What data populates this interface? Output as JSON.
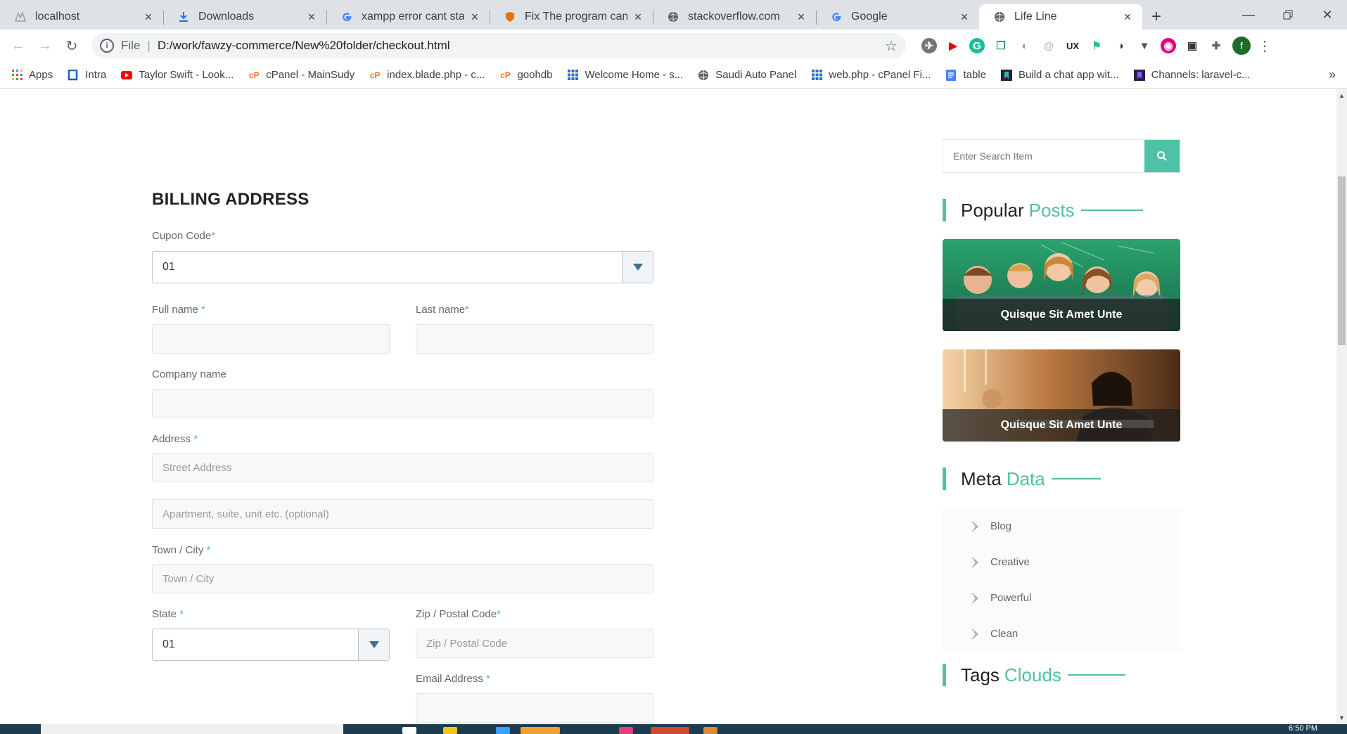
{
  "browser": {
    "tabs": [
      {
        "title": "localhost",
        "icon": "xampp-icon"
      },
      {
        "title": "Downloads",
        "icon": "download-icon"
      },
      {
        "title": "xampp error cant start",
        "icon": "google-icon"
      },
      {
        "title": "Fix The program can't s",
        "icon": "shield-icon"
      },
      {
        "title": "stackoverflow.com",
        "icon": "globe-icon"
      },
      {
        "title": "Google",
        "icon": "google-icon"
      },
      {
        "title": "Life Line",
        "icon": "globe-icon"
      }
    ],
    "address": {
      "scheme": "File",
      "url": "D:/work/fawzy-commerce/New%20folder/checkout.html"
    },
    "profile_initial": "f",
    "bookmarks": [
      {
        "label": "Apps",
        "icon": "apps-grid-icon"
      },
      {
        "label": "Intra",
        "icon": "intra-icon"
      },
      {
        "label": "Taylor Swift - Look...",
        "icon": "youtube-icon"
      },
      {
        "label": "cPanel - MainSudy",
        "icon": "cpanel-icon"
      },
      {
        "label": "index.blade.php - c...",
        "icon": "cpanel-icon"
      },
      {
        "label": "goohdb",
        "icon": "cpanel-icon"
      },
      {
        "label": "Welcome Home - s...",
        "icon": "grid-icon"
      },
      {
        "label": "Saudi Auto Panel",
        "icon": "globe-icon"
      },
      {
        "label": "web.php - cPanel Fi...",
        "icon": "grid-icon"
      },
      {
        "label": "table",
        "icon": "docs-icon"
      },
      {
        "label": "Build a chat app wit...",
        "icon": "book-icon"
      },
      {
        "label": "Channels: laravel-c...",
        "icon": "book-icon"
      }
    ],
    "bookmarks_more": "»"
  },
  "form": {
    "title": "BILLING ADDRESS",
    "coupon": {
      "label": "Cupon Code",
      "value": "01"
    },
    "full_name": {
      "label": "Full name ",
      "placeholder": ""
    },
    "last_name": {
      "label": "Last name",
      "placeholder": ""
    },
    "company": {
      "label": "Company name",
      "placeholder": ""
    },
    "address": {
      "label": "Address ",
      "placeholder": "Street Address",
      "placeholder2": "Apartment, suite, unit etc. (optional)"
    },
    "town": {
      "label": "Town / City ",
      "placeholder": "Town / City"
    },
    "state": {
      "label": "State ",
      "value": "01"
    },
    "zip": {
      "label": "Zip / Postal Code",
      "placeholder": "Zip / Postal Code"
    },
    "email": {
      "label": "Email Address ",
      "placeholder": ""
    },
    "required_mark": "*"
  },
  "sidebar": {
    "search_placeholder": "Enter Search Item",
    "popular": {
      "title": "Popular",
      "accent": "Posts"
    },
    "posts": [
      {
        "caption": "Quisque Sit Amet Unte"
      },
      {
        "caption": "Quisque Sit Amet Unte"
      }
    ],
    "meta": {
      "title": "Meta",
      "accent": "Data",
      "items": [
        "Blog",
        "Creative",
        "Powerful",
        "Clean"
      ]
    },
    "tags": {
      "title": "Tags",
      "accent": "Clouds"
    }
  },
  "taskbar": {
    "time": "6:50 PM"
  },
  "colors": {
    "accent": "#4fc1a6",
    "chrome_bg": "#dee1e6"
  }
}
